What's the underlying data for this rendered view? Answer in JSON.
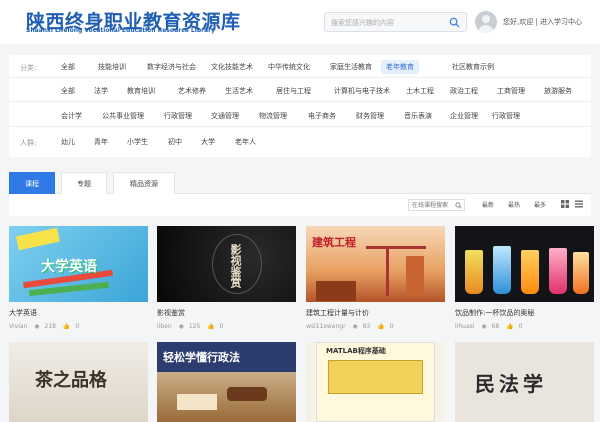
{
  "header": {
    "logo_title": "陕西终身职业教育资源库",
    "logo_subtitle": "Shaanxi Lifelong Vocational Education Resource Library",
    "search_placeholder": "搜索您感兴趣的内容",
    "welcome_text": "您好,欢迎 | 进入学习中心"
  },
  "filters": {
    "category_label": "分类:",
    "categories_row1": [
      "全部",
      "技能培训",
      "数字经济与社会",
      "文化技能艺术",
      "中华传统文化",
      "家庭生活教育",
      "老年教育",
      "社区教育示例"
    ],
    "categories_row2": [
      "全部",
      "法学",
      "教育培训",
      "艺术修养",
      "生活艺术",
      "居住与工程",
      "计算机与电子技术",
      "土木工程",
      "政治工程",
      "工商管理",
      "旅游服务"
    ],
    "categories_row3": [
      "会计学",
      "公共事业管理",
      "行政管理",
      "交通管理",
      "物流管理",
      "电子商务",
      "财务管理",
      "音乐表演",
      "企业管理",
      "行政管理"
    ],
    "crowd_label": "人群:",
    "crowds": [
      "幼儿",
      "青年",
      "小学生",
      "初中",
      "大学",
      "老年人"
    ]
  },
  "tabs": [
    "课程",
    "专题",
    "精品资源"
  ],
  "sortbar": {
    "search_placeholder": "在线课程搜索",
    "sorts": [
      "最新",
      "最热",
      "最多"
    ]
  },
  "cards": [
    {
      "title": "大学英语",
      "author": "Vivian",
      "views": "218",
      "likes": "0",
      "thumb_text": "大学英语"
    },
    {
      "title": "影视鉴赏",
      "author": "liben",
      "views": "125",
      "likes": "0",
      "thumb_text": "影视鉴赏"
    },
    {
      "title": "建筑工程计量与计价",
      "author": "wsl11xwangr",
      "views": "83",
      "likes": "0",
      "thumb_text": "建筑工程"
    },
    {
      "title": "饮品制作:一杯饮品的奥秘",
      "author": "lihuasi",
      "views": "68",
      "likes": "0",
      "thumb_text": ""
    },
    {
      "title": "",
      "author": "",
      "views": "",
      "likes": "",
      "thumb_text": "茶之品格"
    },
    {
      "title": "",
      "author": "",
      "views": "",
      "likes": "",
      "thumb_text": "轻松学懂行政法"
    },
    {
      "title": "",
      "author": "",
      "views": "",
      "likes": "",
      "thumb_text": "MATLAB程序基础"
    },
    {
      "title": "",
      "author": "",
      "views": "",
      "likes": "",
      "thumb_text": "民法学"
    }
  ],
  "colors": {
    "accent": "#2f7ae5",
    "brand": "#1f5fb3"
  },
  "icons": [
    "search-icon",
    "avatar",
    "eye-icon",
    "thumb-up-icon",
    "grid-view-icon",
    "list-view-icon"
  ]
}
